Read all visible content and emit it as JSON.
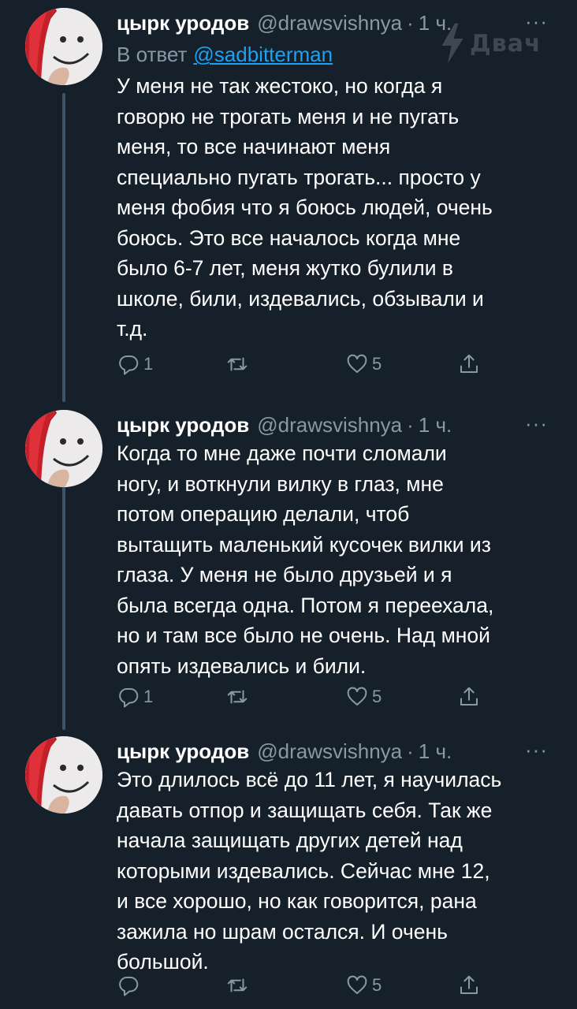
{
  "watermark": {
    "text": "Двач"
  },
  "tweets": [
    {
      "author": "цырк уродов",
      "handle": "@drawsvishnya",
      "separator": "·",
      "time": "1 ч.",
      "more": "···",
      "reply_to": {
        "prefix": "В ответ",
        "mention": "@sadbitterman"
      },
      "lines": [
        "У меня не так жестоко, но когда я",
        "говорю не трогать меня и не пугать",
        "меня, то все начинают меня",
        "специально пугать трогать... просто у",
        "меня фобия что я боюсь людей, очень",
        "боюсь. Это все началось когда мне",
        "было 6-7 лет, меня жутко булили в",
        "школе, били, издевались, обзывали и",
        "т.д."
      ],
      "replies": "1",
      "retweets": "",
      "likes": "5"
    },
    {
      "author": "цырк уродов",
      "handle": "@drawsvishnya",
      "separator": "·",
      "time": "1 ч.",
      "more": "···",
      "lines": [
        "Когда то мне даже почти сломали",
        "ногу, и воткнули вилку в глаз, мне",
        "потом операцию делали, чтоб",
        "вытащить маленький кусочек вилки из",
        "глаза. У меня не было друзьей и я",
        "была всегда одна. Потом я переехала,",
        "но и там все было не очень. Над мной",
        "опять издевались и били."
      ],
      "replies": "1",
      "retweets": "",
      "likes": "5"
    },
    {
      "author": "цырк уродов",
      "handle": "@drawsvishnya",
      "separator": "·",
      "time": "1 ч.",
      "more": "···",
      "lines": [
        "Это длилось всё до 11 лет, я научилась",
        "давать отпор и защищать себя. Так же",
        "начала защищать других детей над",
        "которыми издевались. Сейчас мне 12,",
        "и все хорошо, но как говорится, рана",
        "зажила но шрам остался. И очень",
        "большой."
      ],
      "replies": "",
      "retweets": "",
      "likes": "5"
    }
  ],
  "colors": {
    "background": "#15202b",
    "secondary_text": "#8899a6",
    "link": "#1da1f2",
    "thread_line": "#3d5466"
  },
  "icons": [
    "reply-icon",
    "retweet-icon",
    "like-icon",
    "share-icon",
    "more-icon"
  ]
}
